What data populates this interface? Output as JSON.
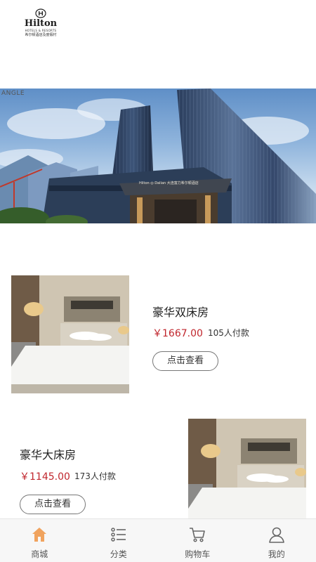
{
  "header": {
    "brand": "Hilton",
    "tagline": "HOTELS & RESORTS",
    "subtitle": "希尔顿酒店及度假村"
  },
  "banner": {
    "watermark": "ANGLE",
    "sign_text": "Hilton ◎ Dalian 大连富力希尔顿酒店"
  },
  "rooms": [
    {
      "title": "豪华双床房",
      "price": "￥1667.00",
      "buyers": "105人付款",
      "button_label": "点击查看"
    },
    {
      "title": "豪华大床房",
      "price": "￥1145.00",
      "buyers": "173人付款",
      "button_label": "点击查看"
    }
  ],
  "tabbar": {
    "tabs": [
      {
        "label": "商城",
        "icon": "home-icon",
        "active": true
      },
      {
        "label": "分类",
        "icon": "list-icon",
        "active": false
      },
      {
        "label": "购物车",
        "icon": "cart-icon",
        "active": false
      },
      {
        "label": "我的",
        "icon": "user-icon",
        "active": false
      }
    ]
  },
  "colors": {
    "accent": "#f0a35e",
    "price": "#c0262d",
    "tab_bar_bg": "#f7f7f7"
  }
}
